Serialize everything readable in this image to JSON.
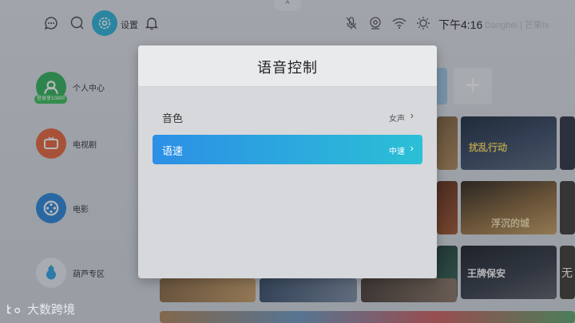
{
  "topbar": {
    "pull_tab_icon": "chevron-up-icon",
    "pull_tab_glyph": "^",
    "settings_label": "设置",
    "clock": "下午4:16",
    "brand": "Dangbei | 芒果tv"
  },
  "sidebar": {
    "items": [
      {
        "label": "个人中心",
        "badge": "登录享1080P",
        "icon": "user-icon",
        "color": "#2fb45a"
      },
      {
        "label": "电视剧",
        "icon": "tv-icon",
        "color": "#e8663a"
      },
      {
        "label": "电影",
        "icon": "film-reel-icon",
        "color": "#2a86d9"
      },
      {
        "label": "葫芦专区",
        "icon": "gourd-icon",
        "color": "#2ea3e5"
      }
    ]
  },
  "thumbnails": {
    "row2_caption_1": "扰乱行动",
    "row3_caption_1": "浮沉的城",
    "row4_caption_1": "王牌保安",
    "row4_caption_2": "无"
  },
  "watermark": "大数跨境",
  "dialog": {
    "title": "语音控制",
    "options": [
      {
        "label": "音色",
        "value": "女声",
        "selected": false
      },
      {
        "label": "语速",
        "value": "中速",
        "selected": true
      }
    ]
  },
  "colors": {
    "accent_start": "#2c8fe6",
    "accent_end": "#2bc0d5",
    "settings_bubble": "#2bb3d9"
  }
}
